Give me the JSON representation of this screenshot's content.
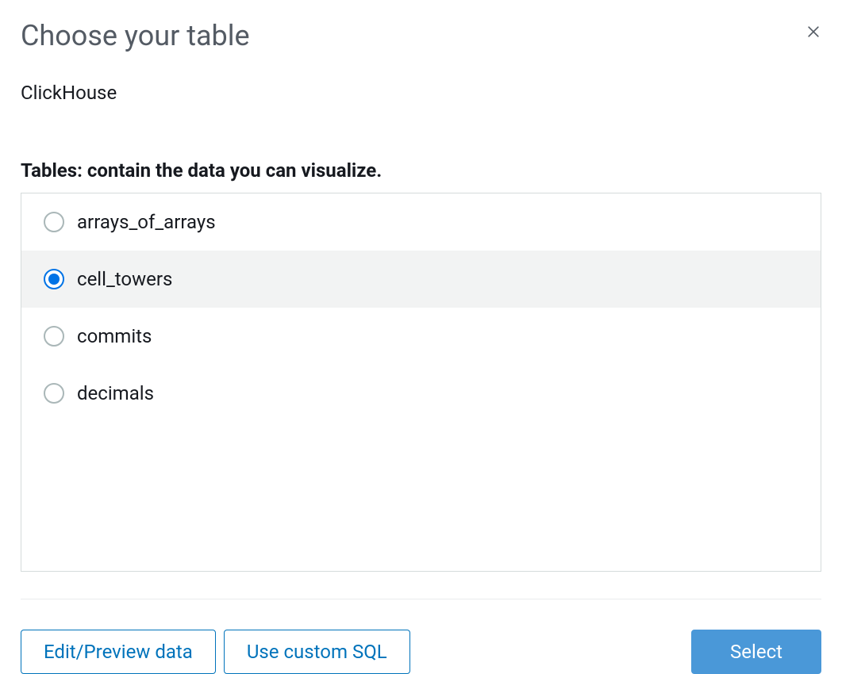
{
  "dialog": {
    "title": "Choose your table",
    "source": "ClickHouse",
    "section_label": "Tables: contain the data you can visualize.",
    "tables": [
      {
        "name": "arrays_of_arrays",
        "selected": false
      },
      {
        "name": "cell_towers",
        "selected": true
      },
      {
        "name": "commits",
        "selected": false
      },
      {
        "name": "decimals",
        "selected": false
      }
    ],
    "buttons": {
      "edit_preview": "Edit/Preview data",
      "custom_sql": "Use custom SQL",
      "select": "Select"
    }
  }
}
